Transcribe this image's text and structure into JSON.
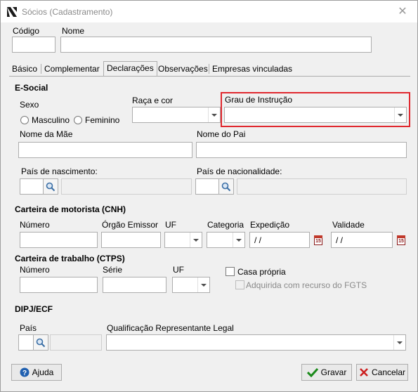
{
  "window": {
    "title": "Sócios (Cadastramento)",
    "close": "✕"
  },
  "header": {
    "codigo_label": "Código",
    "nome_label": "Nome",
    "codigo_value": "",
    "nome_value": ""
  },
  "tabs": [
    {
      "label": "Básico"
    },
    {
      "label": "Complementar"
    },
    {
      "label": "Declarações",
      "active": true
    },
    {
      "label": "Observações"
    },
    {
      "label": "Empresas vinculadas"
    }
  ],
  "esocial": {
    "section": "E-Social",
    "sexo_label": "Sexo",
    "masculino": "Masculino",
    "feminino": "Feminino",
    "raca_label": "Raça e cor",
    "grau_label": "Grau de Instrução",
    "nome_mae_label": "Nome da Mãe",
    "nome_pai_label": "Nome do Pai",
    "pais_nasc_label": "País de nascimento:",
    "pais_nac_label": "País de nacionalidade:"
  },
  "cnh": {
    "section": "Carteira de motorista (CNH)",
    "numero_label": "Número",
    "orgao_label": "Órgão Emissor",
    "uf_label": "UF",
    "categoria_label": "Categoria",
    "expedicao_label": "Expedição",
    "validade_label": "Validade",
    "expedicao_value": "/ /",
    "validade_value": "/ /",
    "cal_text": "15"
  },
  "ctps": {
    "section": "Carteira de trabalho (CTPS)",
    "numero_label": "Número",
    "serie_label": "Série",
    "uf_label": "UF",
    "casa_propria": "Casa própria",
    "fgts": "Adquirida com recurso do FGTS"
  },
  "dipj": {
    "section": "DIPJ/ECF",
    "pais_label": "País",
    "qualificacao_label": "Qualificação Representante Legal"
  },
  "buttons": {
    "ajuda": "Ajuda",
    "gravar": "Gravar",
    "cancelar": "Cancelar"
  },
  "colors": {
    "highlight": "#e0282f",
    "ok_green": "#1a8a1a",
    "cancel_red": "#cc1f1f",
    "help_blue": "#2060b0"
  }
}
